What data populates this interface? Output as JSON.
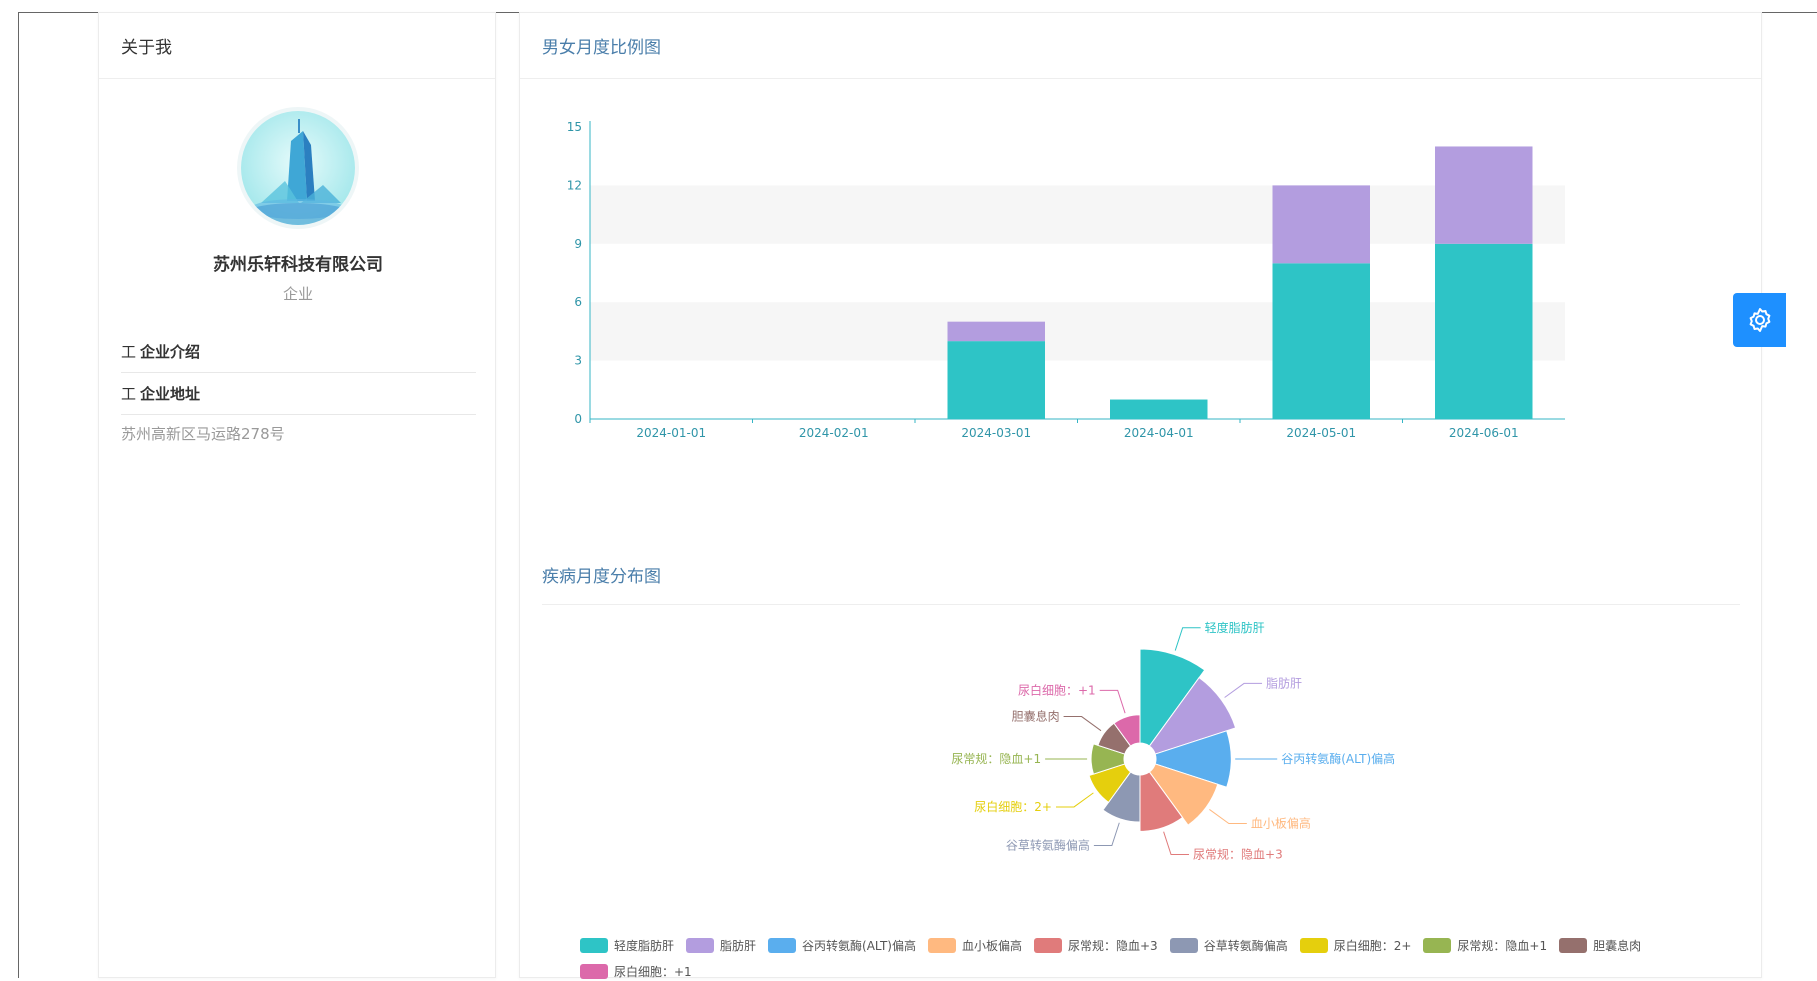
{
  "about": {
    "header": "关于我",
    "company_name": "苏州乐轩科技有限公司",
    "company_type": "企业",
    "intro_label": "企业介绍",
    "address_label": "企业地址",
    "address_value": "苏州高新区马运路278号",
    "row_icon_glyph": "工"
  },
  "bar_section": {
    "title": "男女月度比例图"
  },
  "pie_section": {
    "title": "疾病月度分布图"
  },
  "colors": {
    "teal": "#2ec4c6",
    "purple": "#b39ddf",
    "accent_blue": "#1e90ff",
    "title_blue": "#4a7eaa"
  },
  "icons": {
    "settings": "gear-icon",
    "row": "document-icon"
  },
  "chart_data": [
    {
      "type": "bar",
      "stacked": true,
      "categories": [
        "2024-01-01",
        "2024-02-01",
        "2024-03-01",
        "2024-04-01",
        "2024-05-01",
        "2024-06-01"
      ],
      "series": [
        {
          "values": [
            0,
            0,
            4,
            1,
            8,
            9
          ],
          "color": "#2ec4c6"
        },
        {
          "values": [
            0,
            0,
            1,
            0,
            4,
            5
          ],
          "color": "#b39ddf"
        }
      ],
      "ylim": [
        0,
        15
      ],
      "yticks": [
        0,
        3,
        6,
        9,
        12,
        15
      ],
      "grid": "alternating bands",
      "legend": "none"
    },
    {
      "type": "pie",
      "variant": "rose",
      "legend": "bottom",
      "slices": [
        {
          "label": "轻度脂肪肝",
          "value": 10,
          "color": "#2ec4c6"
        },
        {
          "label": "脂肪肝",
          "value": 9,
          "color": "#b39ddf"
        },
        {
          "label": "谷丙转氨酶(ALT)偏高",
          "value": 8,
          "color": "#5aaeee"
        },
        {
          "label": "血小板偏高",
          "value": 7,
          "color": "#ffb980"
        },
        {
          "label": "尿常规：隐血+3",
          "value": 6,
          "color": "#e07b7b"
        },
        {
          "label": "谷草转氨酶偏高",
          "value": 5,
          "color": "#8d98b3"
        },
        {
          "label": "尿白细胞：2+",
          "value": 4,
          "color": "#e5cf0d"
        },
        {
          "label": "尿常规：隐血+1",
          "value": 3.5,
          "color": "#97b552"
        },
        {
          "label": "胆囊息肉",
          "value": 3,
          "color": "#95706d"
        },
        {
          "label": "尿白细胞：+1",
          "value": 3,
          "color": "#dc69aa"
        }
      ]
    }
  ]
}
